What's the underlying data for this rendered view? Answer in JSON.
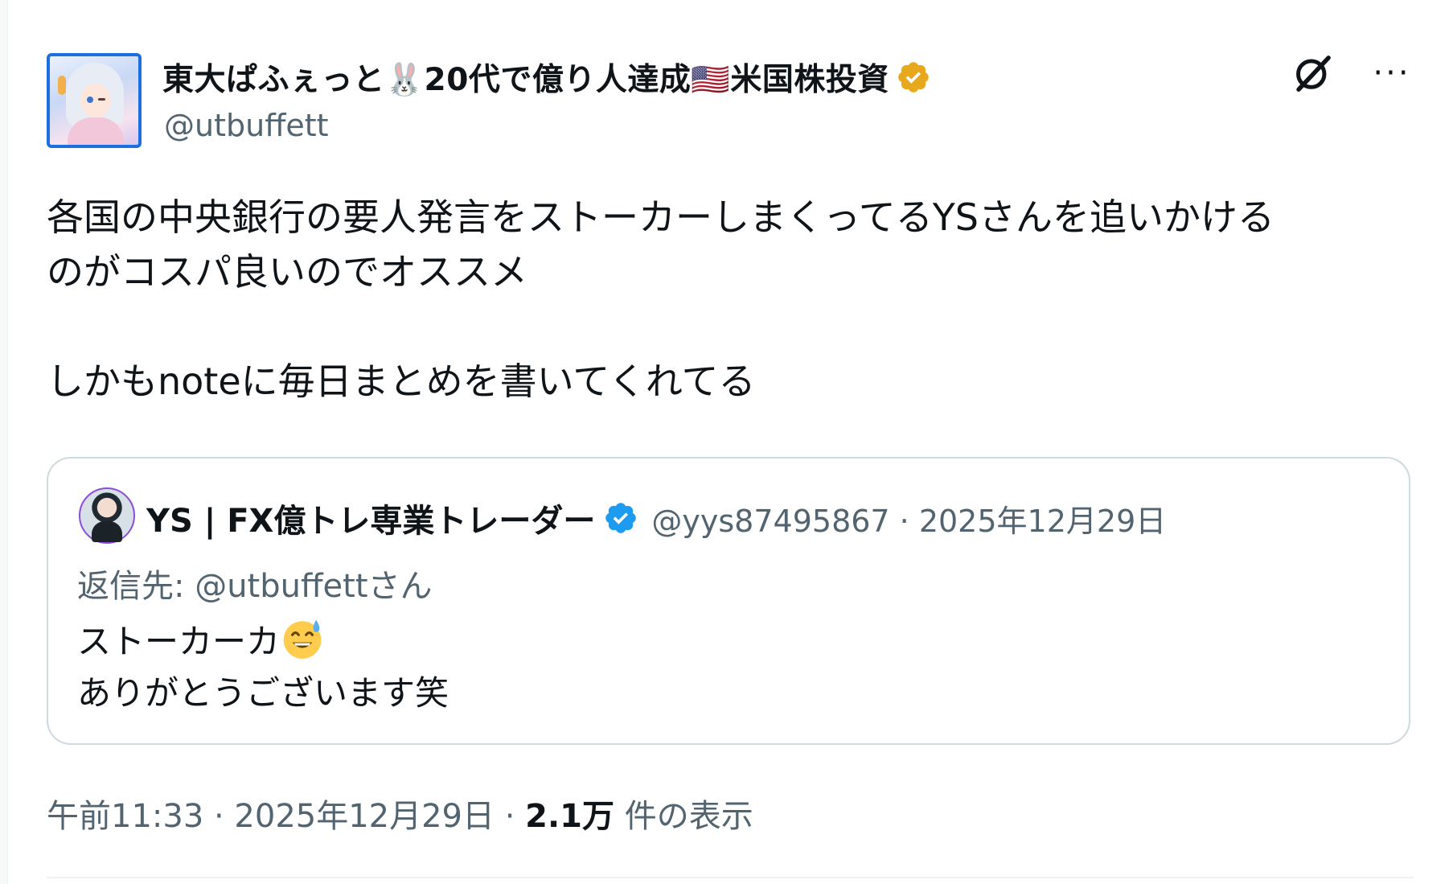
{
  "author": {
    "display_name": "東大ぱふぇっと🐰20代で億り人達成🇺🇸米国株投資",
    "handle": "@utbuffett",
    "verified_badge_color": "#e8a81c",
    "avatar_icon": "anime-girl-avatar"
  },
  "actions": {
    "grok_icon": "grok-icon",
    "more_label": "···"
  },
  "tweet": {
    "text": "各国の中央銀行の要人発言をストーカーしまくってるYSさんを追いかける\nのがコスパ良いのでオススメ\n\nしかもnoteに毎日まとめを書いてくれてる"
  },
  "quote": {
    "display_name": "YS | FX億トレ専業トレーダー",
    "meta": "@yys87495867 · 2025年12月29日",
    "verified_badge_color": "#1d9bf0",
    "reply_to": "返信先: @utbuffettさん",
    "line1": "ストーカーカ",
    "emoji": "grinning-sweat-emoji",
    "line2": "ありがとうございます笑"
  },
  "footer": {
    "time_date": "午前11:33 · 2025年12月29日 · ",
    "views_count": "2.1万",
    "views_label": " 件の表示"
  }
}
